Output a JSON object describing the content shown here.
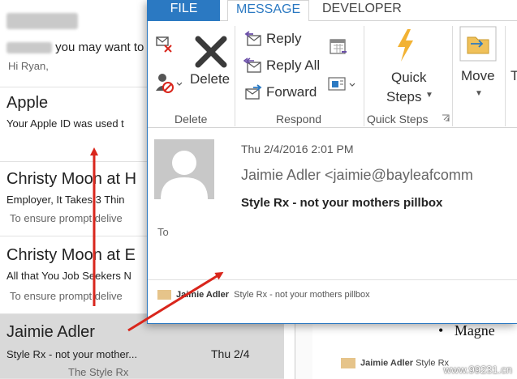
{
  "mail_list": {
    "items": [
      {
        "sender": "",
        "subject_tail": "you may want to",
        "preview": "Hi Ryan,"
      },
      {
        "sender": "Apple",
        "subject": "Your Apple ID was used t",
        "preview": ""
      },
      {
        "sender": "Christy Moon at H",
        "subject": "Employer, It Takes 3 Thin",
        "preview": "To ensure prompt delive"
      },
      {
        "sender": "Christy Moon at E",
        "subject": "All that You Job Seekers N",
        "preview": "To ensure prompt delive"
      },
      {
        "sender": "Jaimie Adler",
        "subject": "Style Rx - not your mother...",
        "date": "Thu 2/4",
        "preview": "The Style Rx"
      }
    ]
  },
  "background": {
    "bullet_text": "Magne",
    "footer_sender": "Jaimie Adler",
    "footer_subject": "Style Rx"
  },
  "window": {
    "tabs": {
      "file": "FILE",
      "message": "MESSAGE",
      "developer": "DEVELOPER"
    },
    "ribbon": {
      "delete_group": {
        "delete_label": "Delete",
        "group_label": "Delete"
      },
      "respond_group": {
        "reply": "Reply",
        "reply_all": "Reply All",
        "forward": "Forward",
        "group_label": "Respond"
      },
      "quicksteps_group": {
        "quick_steps_line1": "Quick",
        "quick_steps_line2": "Steps",
        "group_label": "Quick Steps"
      },
      "move_group": {
        "move_label": "Move",
        "cut_label": "T"
      }
    },
    "message": {
      "date": "Thu 2/4/2016 2:01 PM",
      "from": "Jaimie Adler <jaimie@bayleafcomm",
      "subject": "Style Rx - not your mothers pillbox",
      "to_label": "To",
      "footer_sender": "Jaimie Adler",
      "footer_subject": "Style Rx - not your mothers pillbox"
    }
  },
  "watermark": "www.99231.cn",
  "colors": {
    "accent": "#2b79c2",
    "annotation": "#d9261c"
  }
}
